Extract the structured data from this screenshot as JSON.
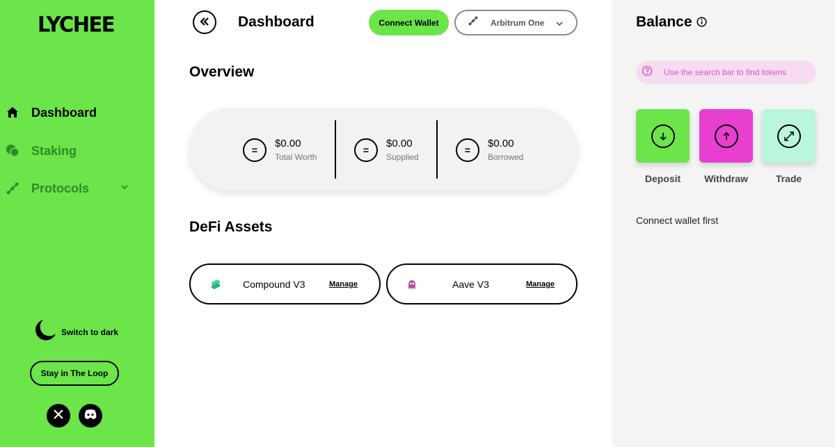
{
  "brand": {
    "logo_text": "LYCHEE"
  },
  "sidebar": {
    "items": [
      {
        "label": "Dashboard",
        "icon": "home-icon",
        "active": true
      },
      {
        "label": "Staking",
        "icon": "staking-icon",
        "active": false
      },
      {
        "label": "Protocols",
        "icon": "protocols-icon",
        "active": false,
        "expandable": true
      }
    ],
    "dark_toggle_label": "Switch to dark",
    "loop_button_label": "Stay in The Loop",
    "socials": [
      {
        "name": "x-icon"
      },
      {
        "name": "discord-icon"
      }
    ]
  },
  "header": {
    "title": "Dashboard",
    "connect_wallet_label": "Connect Wallet",
    "network": {
      "selected": "Arbitrum One"
    }
  },
  "overview": {
    "title": "Overview",
    "stats": [
      {
        "value": "$0.00",
        "label": "Total Worth",
        "symbol": "="
      },
      {
        "value": "$0.00",
        "label": "Supplied",
        "symbol": "="
      },
      {
        "value": "$0.00",
        "label": "Borrowed",
        "symbol": "="
      }
    ]
  },
  "defi": {
    "title": "DeFi Assets",
    "assets": [
      {
        "name": "Compound V3",
        "action": "Manage"
      },
      {
        "name": "Aave V3",
        "action": "Manage"
      }
    ]
  },
  "balance": {
    "title": "Balance",
    "search_hint": "Use the search bar to find tokens",
    "actions": [
      {
        "label": "Deposit",
        "color": "#6be54a"
      },
      {
        "label": "Withdraw",
        "color": "#e83fd0"
      },
      {
        "label": "Trade",
        "color": "#b9f6dc"
      }
    ],
    "empty_state": "Connect wallet first"
  },
  "colors": {
    "brand_green": "#6be54a",
    "accent_pink": "#e83fd0",
    "mint": "#b9f6dc",
    "panel_bg": "#f4f4f4"
  }
}
